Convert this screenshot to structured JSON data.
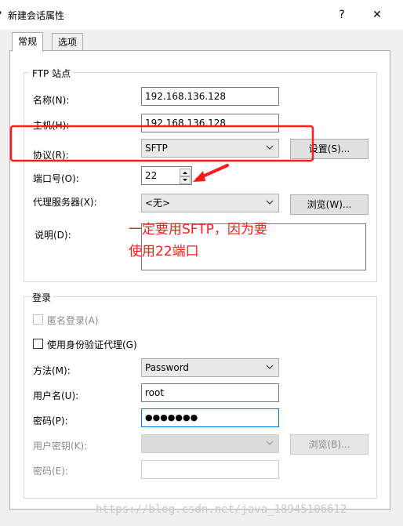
{
  "window": {
    "title": "新建会话属性",
    "help_glyph": "?",
    "close_glyph": "✕",
    "left_edge_glyph": "?"
  },
  "tabs": [
    {
      "label": "常规",
      "active": true
    },
    {
      "label": "选项",
      "active": false
    }
  ],
  "ftp_site": {
    "group_title": "FTP 站点",
    "name": {
      "label": "名称(N):",
      "value": "192.168.136.128"
    },
    "host": {
      "label": "主机(H):",
      "value": "192.168.136.128"
    },
    "protocol": {
      "label": "协议(R):",
      "value": "SFTP",
      "button": "设置(S)..."
    },
    "port": {
      "label": "端口号(O):",
      "value": "22"
    },
    "proxy": {
      "label": "代理服务器(X):",
      "value": "<无>",
      "button": "浏览(W)..."
    },
    "description": {
      "label": "说明(D):",
      "value": ""
    }
  },
  "login": {
    "group_title": "登录",
    "anonymous": {
      "label": "匿名登录(A)",
      "checked": false,
      "disabled": true
    },
    "agent": {
      "label": "使用身份验证代理(G)",
      "checked": false
    },
    "method": {
      "label": "方法(M):",
      "value": "Password"
    },
    "username": {
      "label": "用户名(U):",
      "value": "root"
    },
    "password": {
      "label": "密码(P):",
      "value": "●●●●●●●"
    },
    "user_key": {
      "label": "用户密钥(K):",
      "value": "",
      "button": "浏览(B)..."
    },
    "passphrase": {
      "label": "密码(E):",
      "value": ""
    }
  },
  "annotation": {
    "line1": "一定要用SFTP，因为要",
    "line2": "使用22端口",
    "color": "#ff1a1a"
  },
  "watermark": "https://blog.csdn.net/java_18945106612",
  "colors": {
    "focus": "#0078d7",
    "annotation": "#ff1a1a"
  }
}
